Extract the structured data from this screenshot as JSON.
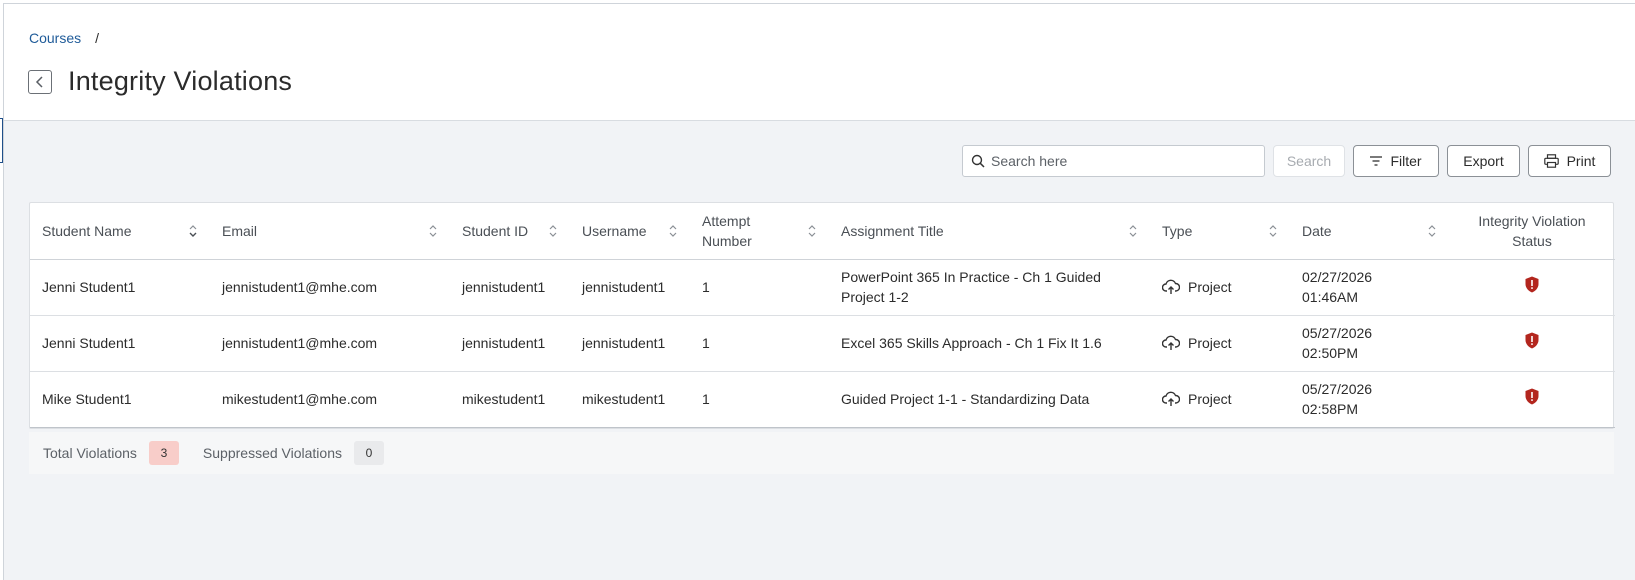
{
  "breadcrumb": {
    "courses": "Courses",
    "separator": "/"
  },
  "page": {
    "title": "Integrity Violations"
  },
  "toolbar": {
    "search_placeholder": "Search here",
    "search_button": "Search",
    "filter_button": "Filter",
    "export_button": "Export",
    "print_button": "Print"
  },
  "table": {
    "headers": {
      "student_name": "Student Name",
      "email": "Email",
      "student_id": "Student ID",
      "username": "Username",
      "attempt_1": "Attempt",
      "attempt_2": "Number",
      "assignment_title": "Assignment Title",
      "type": "Type",
      "date": "Date",
      "status_1": "Integrity Violation",
      "status_2": "Status"
    },
    "rows": [
      {
        "student_name": "Jenni Student1",
        "email": "jennistudent1@mhe.com",
        "student_id": "jennistudent1",
        "username": "jennistudent1",
        "attempt": "1",
        "assignment_title": "PowerPoint 365 In Practice - Ch 1 Guided Project 1-2",
        "type": "Project",
        "date": "02/27/2026",
        "time": "01:46AM"
      },
      {
        "student_name": "Jenni Student1",
        "email": "jennistudent1@mhe.com",
        "student_id": "jennistudent1",
        "username": "jennistudent1",
        "attempt": "1",
        "assignment_title": "Excel 365 Skills Approach - Ch 1 Fix It 1.6",
        "type": "Project",
        "date": "05/27/2026",
        "time": "02:50PM"
      },
      {
        "student_name": "Mike Student1",
        "email": "mikestudent1@mhe.com",
        "student_id": "mikestudent1",
        "username": "mikestudent1",
        "attempt": "1",
        "assignment_title": "Guided Project 1-1 - Standardizing Data",
        "type": "Project",
        "date": "05/27/2026",
        "time": "02:58PM"
      }
    ]
  },
  "summary": {
    "total_label": "Total Violations",
    "total_count": "3",
    "suppressed_label": "Suppressed Violations",
    "suppressed_count": "0"
  },
  "colors": {
    "link": "#1f5b99",
    "violation": "#b3261e",
    "background": "#f1f3f6"
  },
  "icons": [
    "chevron-left-icon",
    "search-icon",
    "filter-icon",
    "print-icon",
    "sort-icon",
    "cloud-upload-icon",
    "shield-alert-icon"
  ]
}
